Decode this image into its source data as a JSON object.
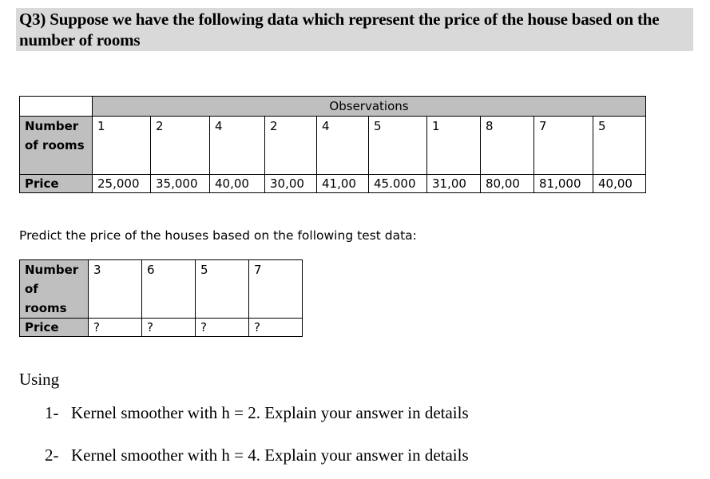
{
  "question": {
    "title": "Q3) Suppose we have the following data which represent the price of the house based on the number of rooms"
  },
  "training_table": {
    "group_header": "Observations",
    "row_labels": {
      "rooms": "Number of rooms",
      "price": "Price"
    },
    "rooms": [
      "1",
      "2",
      "4",
      "2",
      "4",
      "5",
      "1",
      "8",
      "7",
      "5"
    ],
    "prices": [
      "25,000",
      "35,000",
      "40,00",
      "30,00",
      "41,00",
      "45.000",
      "31,00",
      "80,00",
      "81,000",
      "40,00"
    ]
  },
  "predict_prompt": "Predict the price of the houses based on the following test data:",
  "test_table": {
    "row_labels": {
      "rooms": "Number of rooms",
      "price": "Price"
    },
    "rooms": [
      "3",
      "6",
      "5",
      "7"
    ],
    "prices": [
      "?",
      "?",
      "?",
      "?"
    ]
  },
  "instructions": {
    "intro": "Using",
    "tasks": [
      {
        "number": "1-",
        "text": "Kernel smoother with h = 2.  Explain your answer in details"
      },
      {
        "number": "2-",
        "text": "Kernel smoother with h = 4.  Explain your answer in details"
      }
    ]
  }
}
